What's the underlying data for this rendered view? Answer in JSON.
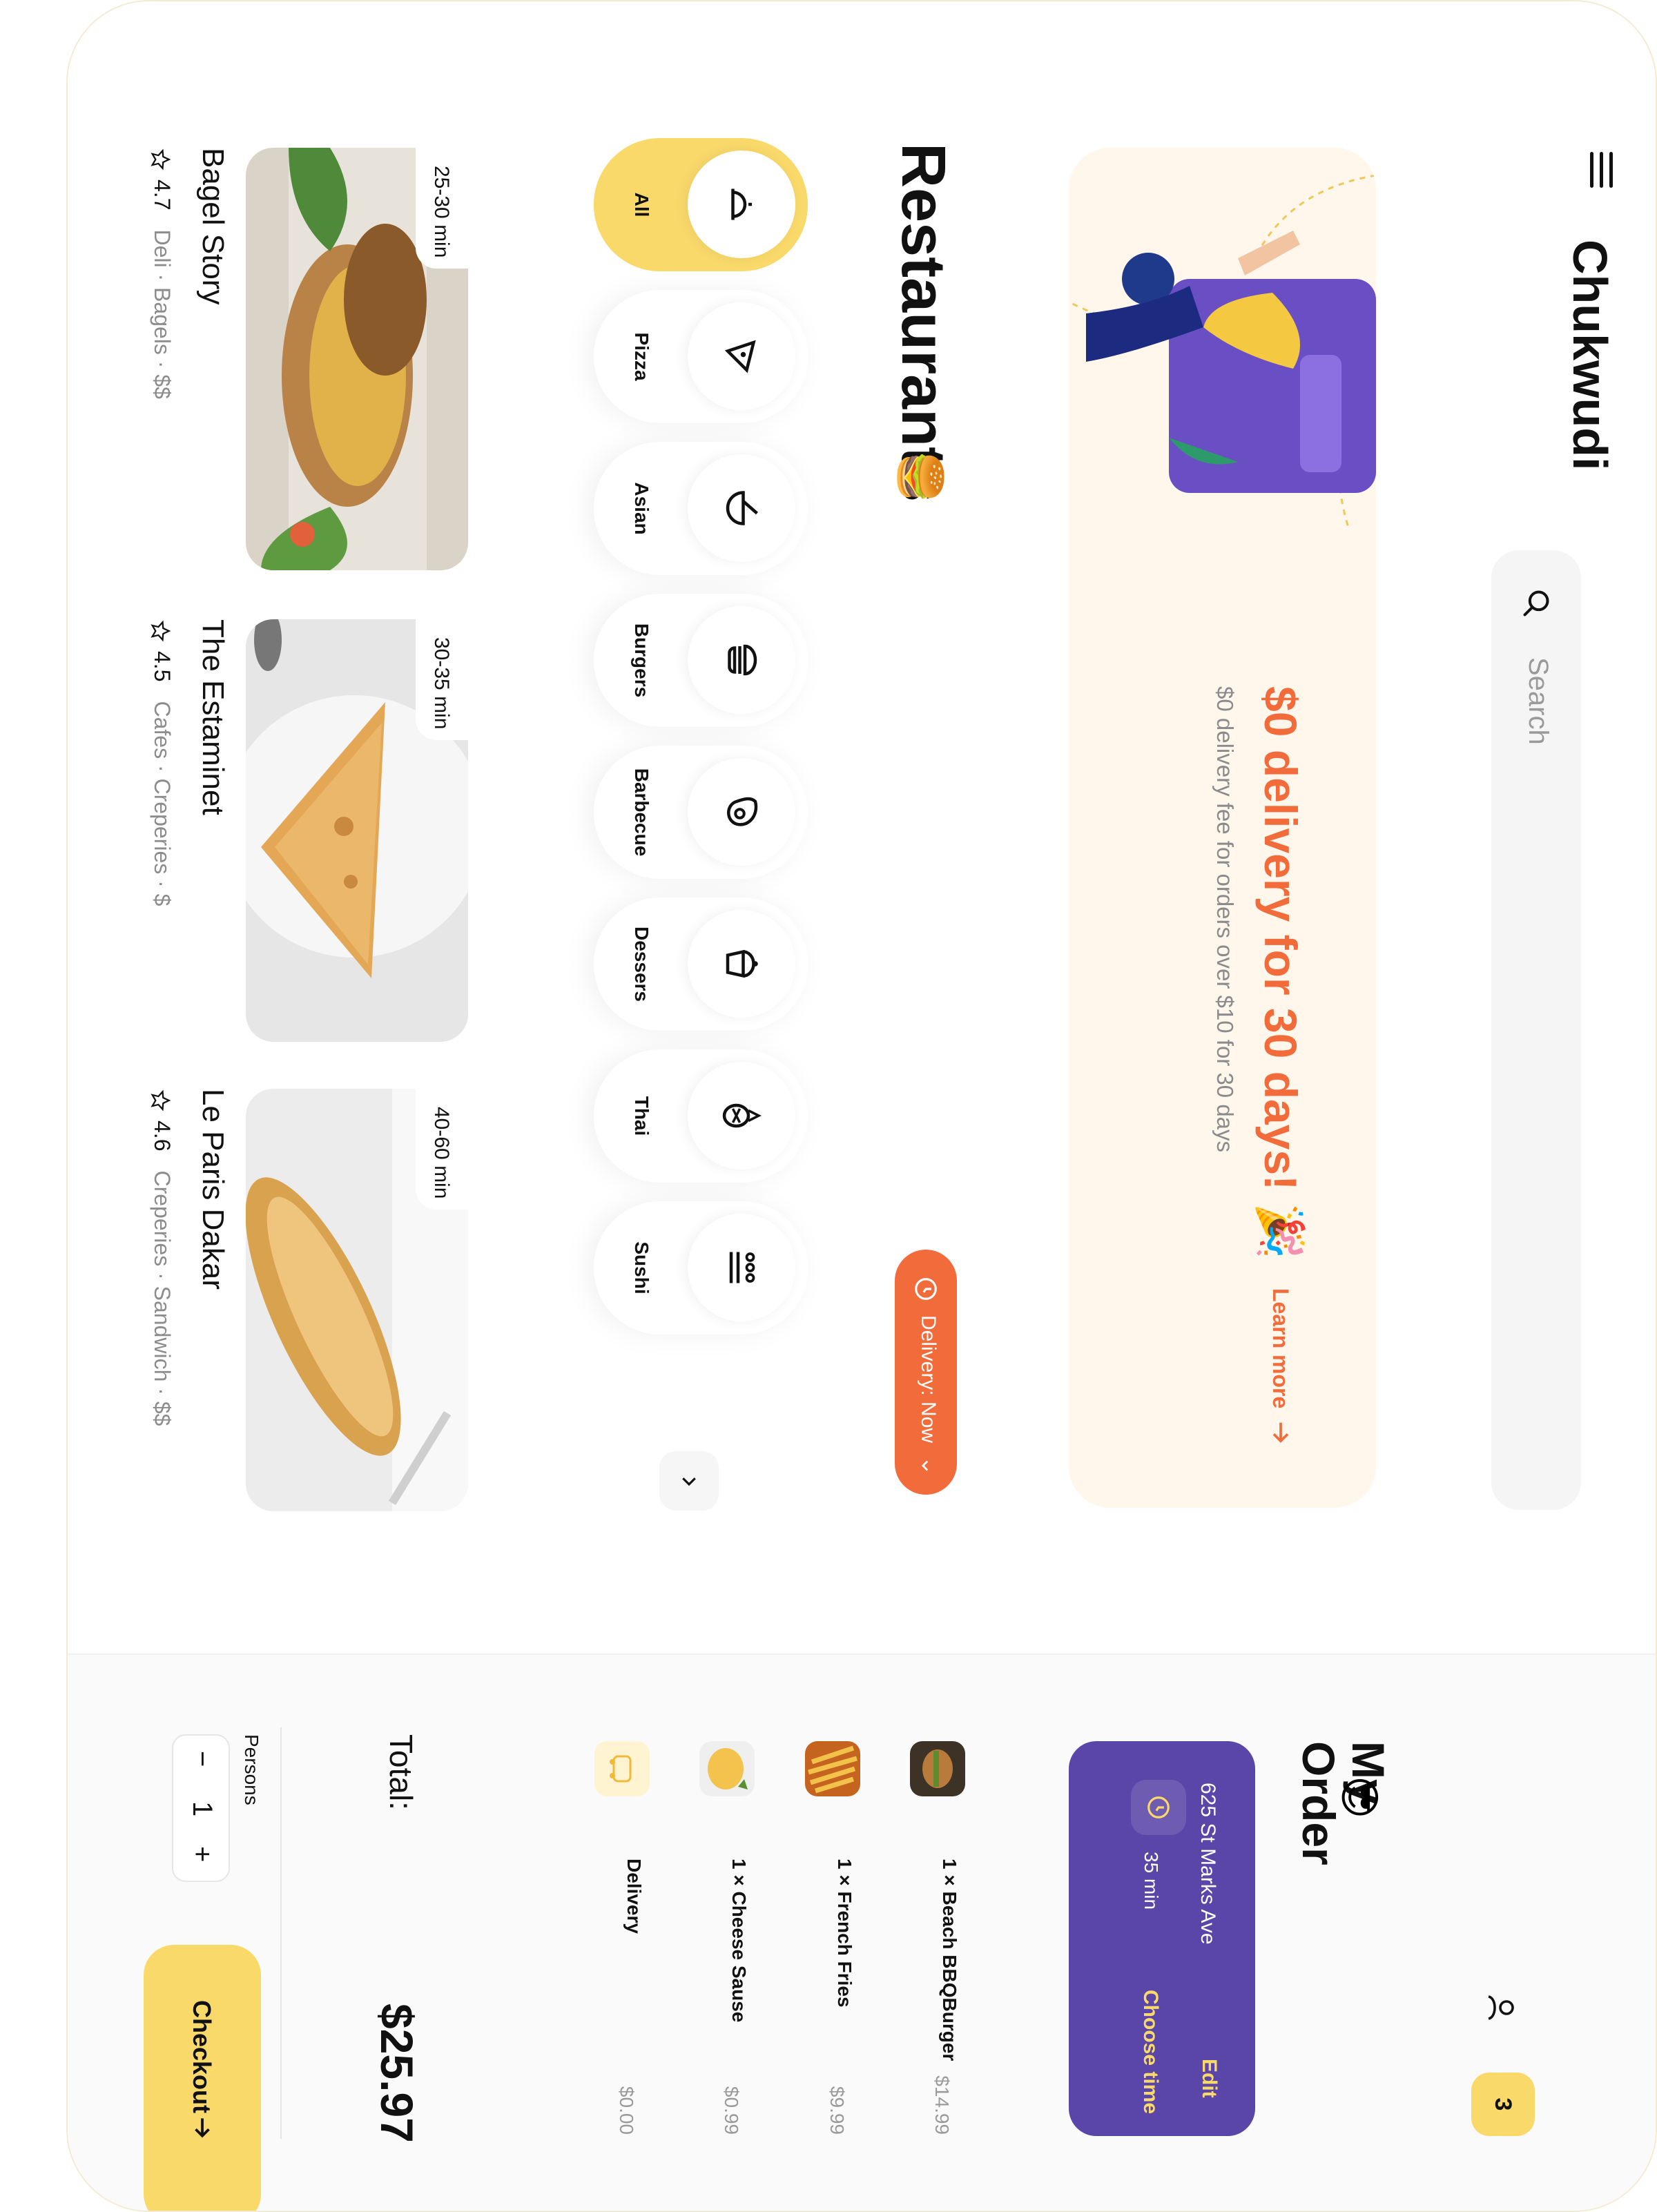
{
  "header": {
    "brand": "Chukwudi",
    "search_placeholder": "Search"
  },
  "banner": {
    "title": "$0 delivery for 30 days!",
    "emoji": "🎉",
    "subtitle": "$0 delivery fee for orders over $10 for 30 days",
    "link": "Learn more"
  },
  "restaurants": {
    "title": "Restaurants",
    "emoji": "🍔",
    "delivery_button": "Delivery: Now",
    "categories": [
      {
        "label": "All",
        "icon": "cloche-icon",
        "active": true
      },
      {
        "label": "Pizza",
        "icon": "pizza-icon"
      },
      {
        "label": "Asian",
        "icon": "bowl-icon"
      },
      {
        "label": "Burgers",
        "icon": "burger-icon"
      },
      {
        "label": "Barbecue",
        "icon": "meat-icon"
      },
      {
        "label": "Dessers",
        "icon": "cupcake-icon"
      },
      {
        "label": "Thai",
        "icon": "pineapple-icon"
      },
      {
        "label": "Sushi",
        "icon": "sushi-icon"
      }
    ],
    "cards": [
      {
        "name": "Bagel Story",
        "time": "25-30 min",
        "rating": "4.7",
        "meta": "Deli · Bagels · $$"
      },
      {
        "name": "The Estaminet",
        "time": "30-35 min",
        "rating": "4.5",
        "meta": "Cafes · Creperies · $"
      },
      {
        "name": "Le Paris Dakar",
        "time": "40-60 min",
        "rating": "4.6",
        "meta": "Creperies · Sandwich · $$"
      }
    ]
  },
  "order": {
    "title_line1": "My",
    "title_line2": "Order",
    "emoji": "😎",
    "cart_count": "3",
    "address": "625 St Marks Ave",
    "edit": "Edit",
    "eta": "35 min",
    "choose_time": "Choose time",
    "items": [
      {
        "qty": "1 ×",
        "name": "Beach BBQBurger",
        "price": "$14.99"
      },
      {
        "qty": "1 ×",
        "name": "French Fries",
        "price": "$9.99"
      },
      {
        "qty": "1 ×",
        "name": "Cheese Sause",
        "price": "$0.99"
      },
      {
        "qty": "",
        "name": "Delivery",
        "price": "$0.00"
      }
    ],
    "total_label": "Total:",
    "total_value": "$25.97",
    "persons_label": "Persons",
    "persons_value": "1",
    "minus": "−",
    "plus": "+",
    "checkout": "Checkout"
  },
  "colors": {
    "accent": "#f9d96a",
    "orange": "#f26b3a",
    "purple": "#5a45a8"
  }
}
